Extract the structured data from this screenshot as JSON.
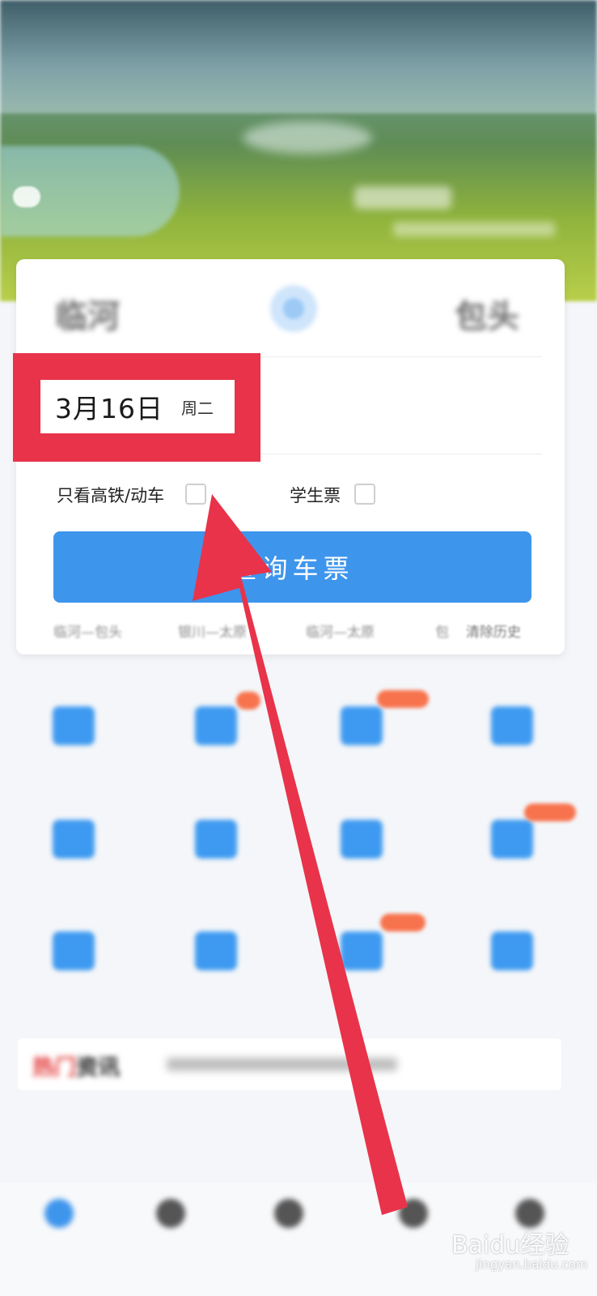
{
  "banner": {
    "weather_text": "",
    "caption": ""
  },
  "route": {
    "from_city": "临河",
    "to_city": "包头"
  },
  "date": {
    "day": "3月16日",
    "weekday": "周二"
  },
  "options": {
    "gaotie_label": "只看高铁/动车",
    "student_label": "学生票"
  },
  "query_button_label": "查询车票",
  "history": [
    "临河—包头",
    "银川—太原",
    "临河—太原",
    "包"
  ],
  "clear_history_label": "清除历史",
  "grid": [
    {
      "label": "",
      "icon": "calendar-icon"
    },
    {
      "label": "",
      "icon": "ticket-icon"
    },
    {
      "label": "",
      "icon": "ticket-icon"
    },
    {
      "label": "",
      "icon": "plus-icon"
    },
    {
      "label": "",
      "icon": "mountain-icon"
    },
    {
      "label": "",
      "icon": "car-icon"
    },
    {
      "label": "",
      "icon": "hotel-icon"
    },
    {
      "label": "",
      "icon": "document-icon"
    },
    {
      "label": "",
      "icon": "meal-icon"
    },
    {
      "label": "",
      "icon": "cart-icon"
    },
    {
      "label": "",
      "icon": "ball-icon"
    },
    {
      "label": "",
      "icon": "book-icon"
    }
  ],
  "news": {
    "title_accent": "热门",
    "title_rest": "资讯"
  },
  "section": {
    "title": "",
    "more": ""
  },
  "tabs": [
    {
      "label": "",
      "icon": "home-icon"
    },
    {
      "label": "",
      "icon": "service-icon"
    },
    {
      "label": "",
      "icon": "order-icon"
    },
    {
      "label": "",
      "icon": "travel-icon"
    },
    {
      "label": "",
      "icon": "profile-icon"
    }
  ],
  "watermark": {
    "brand": "Baidu经验",
    "url": "jingyan.baidu.com"
  },
  "colors": {
    "accent": "#3e95ec",
    "highlight": "#e8334a",
    "badge": "#f7734d"
  }
}
